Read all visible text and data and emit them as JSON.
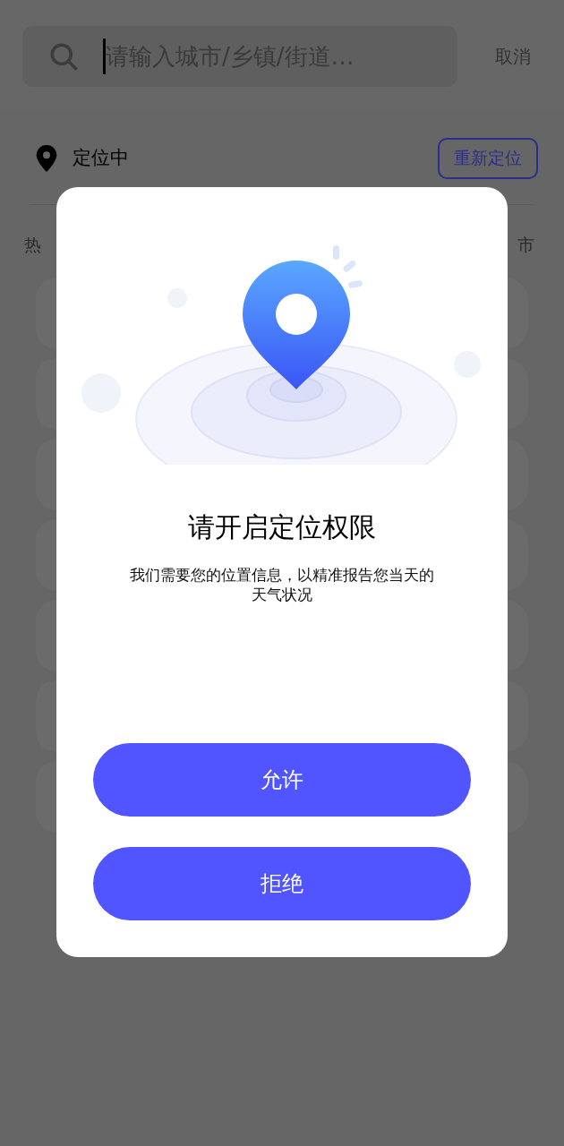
{
  "search": {
    "placeholder": "请输入城市/乡镇/街道…",
    "cancel": "取消"
  },
  "location": {
    "status": "定位中",
    "relocate": "重新定位"
  },
  "section": {
    "left_label": "热",
    "right_label": "市"
  },
  "dialog": {
    "title": "请开启定位权限",
    "message": "我们需要您的位置信息，以精准报告您当天的天气状况",
    "buttons": [
      {
        "label": "允许"
      },
      {
        "label": "拒绝"
      }
    ]
  }
}
